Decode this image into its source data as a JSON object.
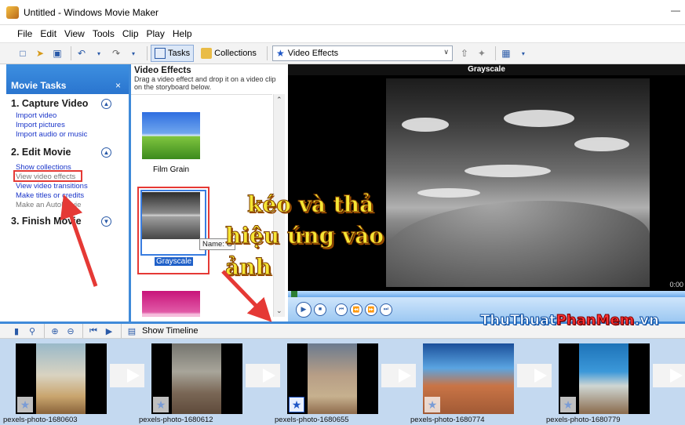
{
  "window": {
    "title": "Untitled - Windows Movie Maker",
    "minimize": "—"
  },
  "menu": [
    "File",
    "Edit",
    "View",
    "Tools",
    "Clip",
    "Play",
    "Help"
  ],
  "toolbar": {
    "tasks_label": "Tasks",
    "collections_label": "Collections",
    "collection_selected": "Video Effects"
  },
  "task_pane": {
    "header": "Movie Tasks",
    "close": "×",
    "sections": [
      {
        "title": "1. Capture Video",
        "links": [
          "Import video",
          "Import pictures",
          "Import audio or music"
        ]
      },
      {
        "title": "2. Edit Movie",
        "links": [
          "Show collections",
          "View video effects",
          "View video transitions",
          "Make titles or credits",
          "Make an AutoMovie"
        ]
      },
      {
        "title": "3. Finish Movie",
        "links": []
      }
    ]
  },
  "effects_panel": {
    "title": "Video Effects",
    "description": "Drag a video effect and drop it on a video clip on the storyboard below.",
    "items": [
      {
        "label": "Film Grain"
      },
      {
        "label": "Grayscale"
      },
      {
        "label": ""
      }
    ],
    "tooltip": "Name: G"
  },
  "preview": {
    "title": "Grayscale",
    "time": "0:00"
  },
  "annotation": {
    "line1": "kéo và thả",
    "line2": "hiệu ứng vào",
    "line3": "ảnh"
  },
  "watermark": {
    "part1": "ThuThuat",
    "part2": "PhanMem",
    "part3": ".vn"
  },
  "storyboard_toolbar": {
    "show_timeline": "Show Timeline"
  },
  "storyboard": {
    "clips": [
      {
        "name": "pexels-photo-1680603"
      },
      {
        "name": "pexels-photo-1680612"
      },
      {
        "name": "pexels-photo-1680655"
      },
      {
        "name": "pexels-photo-1680774"
      },
      {
        "name": "pexels-photo-1680779"
      }
    ]
  },
  "colors": {
    "accent_blue": "#3f8ad9",
    "highlight_red": "#e53935",
    "annotation_yellow": "#f6e634"
  }
}
